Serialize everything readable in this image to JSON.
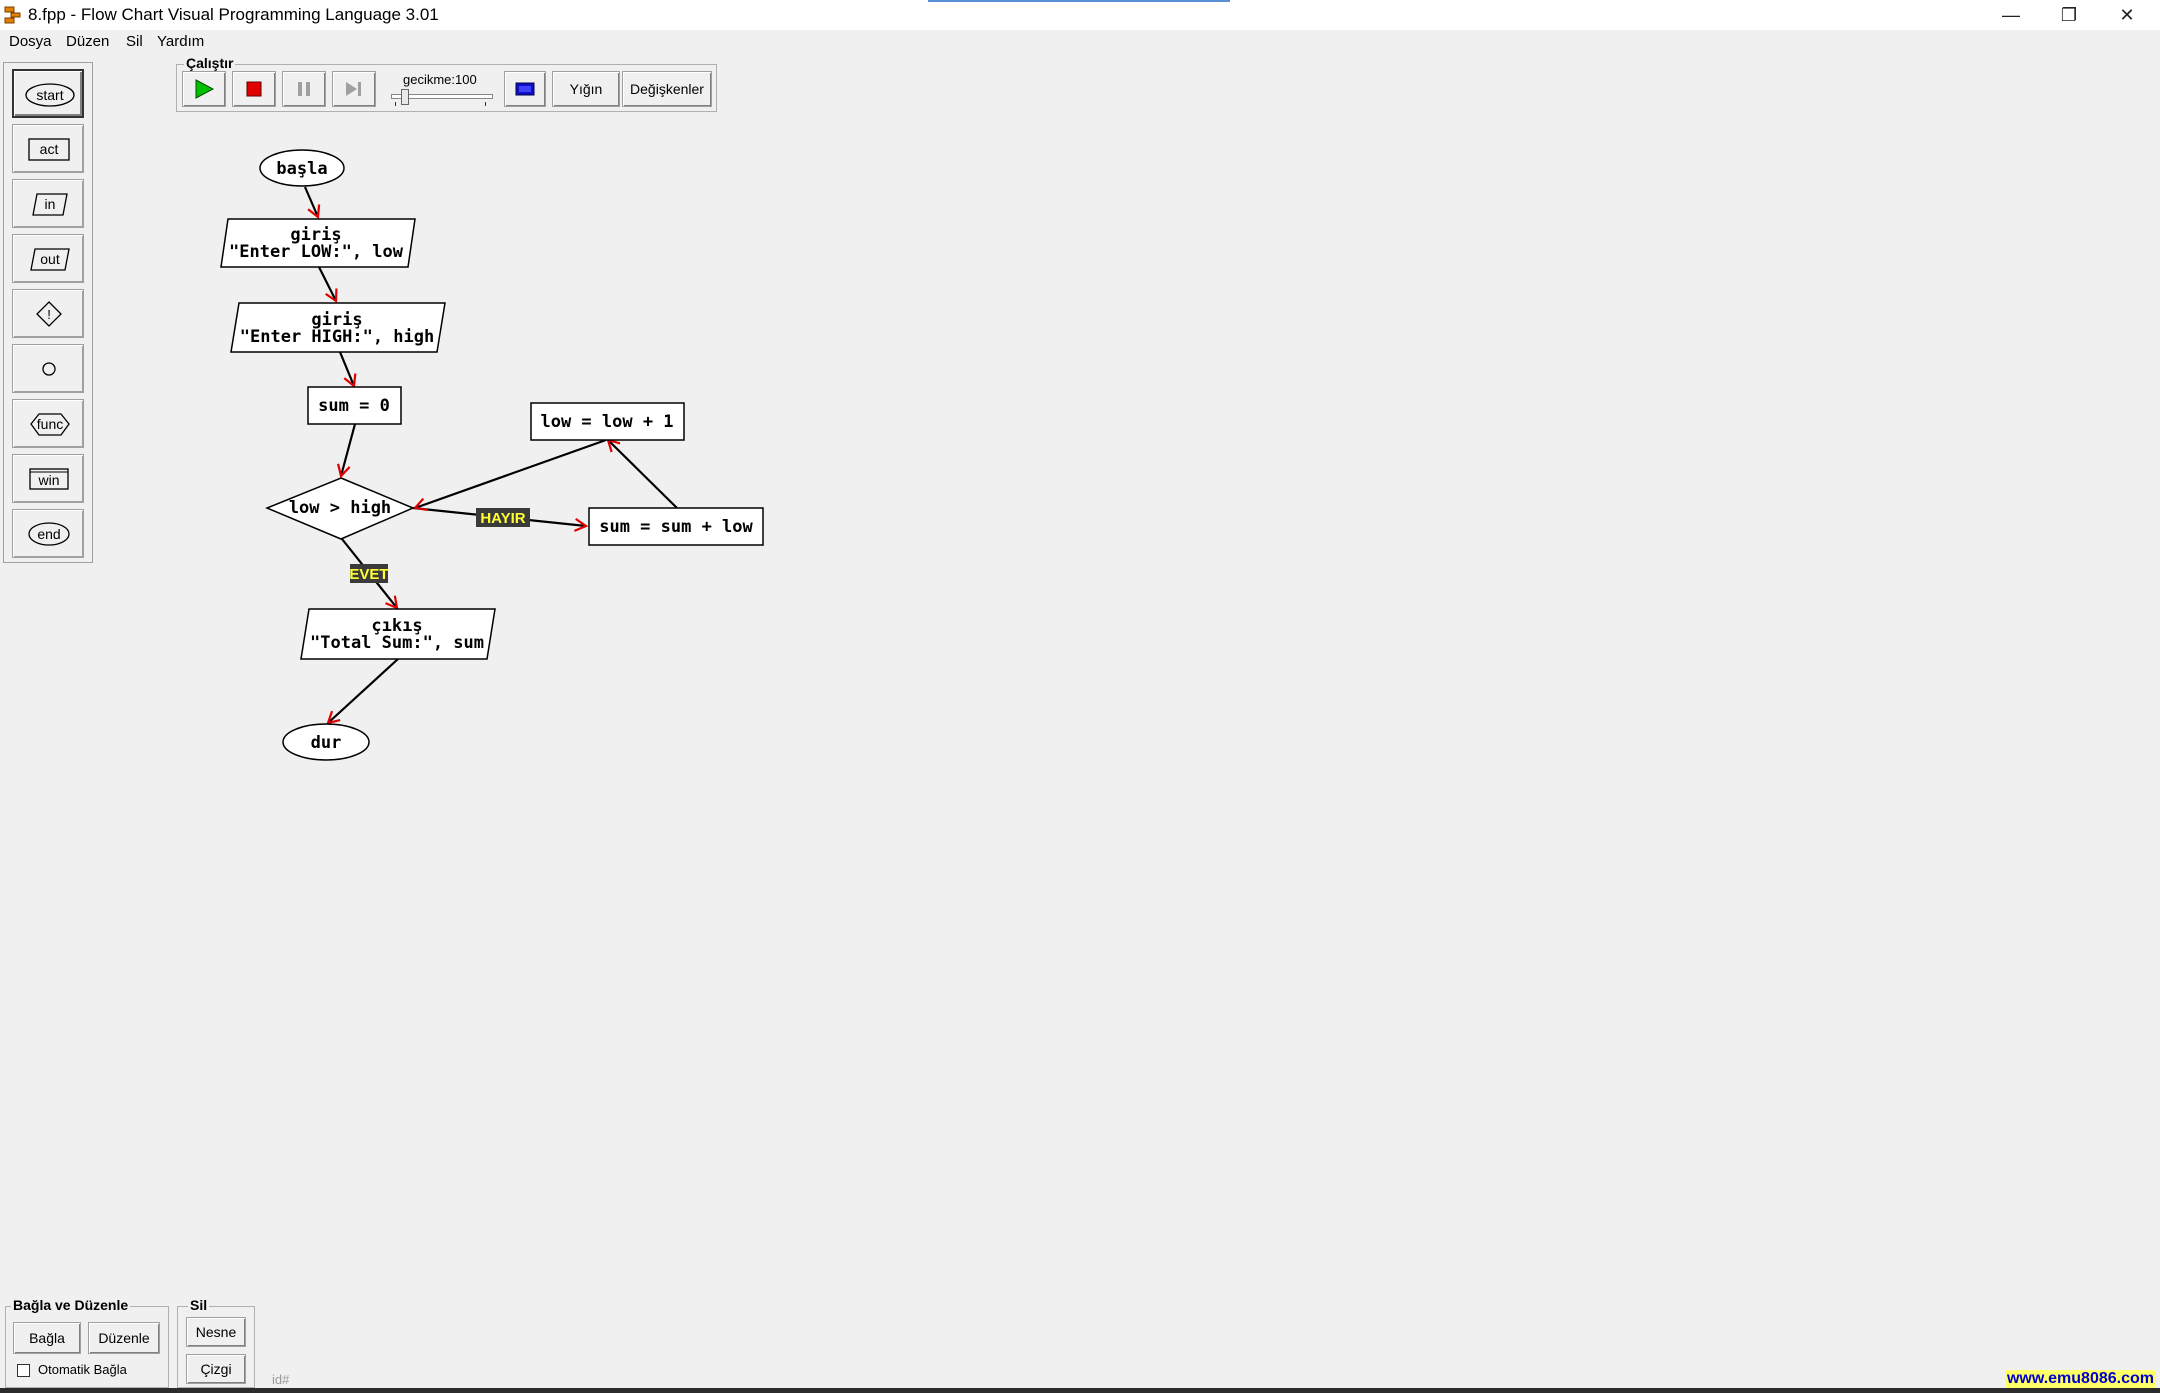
{
  "window": {
    "title": "8.fpp - Flow Chart Visual Programming Language 3.01",
    "controls": [
      "—",
      "❐",
      "✕"
    ]
  },
  "menu": [
    "Dosya",
    "Düzen",
    "Sil",
    "Yardım"
  ],
  "palette": {
    "items": [
      "start",
      "act",
      "in",
      "out",
      "",
      "",
      "func",
      "win",
      "end"
    ],
    "selected": "start"
  },
  "run_group": {
    "label": "Çalıştır",
    "delay_label": "gecikme:100",
    "delay_value": 100,
    "stack_label": "Yığın",
    "variables_label": "Değişkenler"
  },
  "flowchart": {
    "start": "başla",
    "input1": [
      "giriş",
      "\"Enter LOW:\", low"
    ],
    "input2": [
      "giriş",
      "\"Enter HIGH:\", high"
    ],
    "init": "sum = 0",
    "condition": "low > high",
    "increment": "low = low + 1",
    "accumulate": "sum = sum + low",
    "no_label": "HAYIR",
    "yes_label": "EVET",
    "output": [
      "çıkış",
      "\"Total Sum:\", sum"
    ],
    "end": "dur"
  },
  "bottom": {
    "connect_group_label": "Bağla ve Düzenle",
    "connect_label": "Bağla",
    "edit_label": "Düzenle",
    "auto_connect_label": "Otomatik Bağla",
    "auto_connect_checked": false,
    "delete_group_label": "Sil",
    "object_label": "Nesne",
    "line_label": "Çizgi",
    "id_mark": "id#"
  },
  "footer_link": "www.emu8086.com",
  "colors": {
    "arrow": "#e00000",
    "tag_bg": "#3a3a3a",
    "tag_fg": "#ffff33",
    "play": "#00c000",
    "stop": "#e00000"
  }
}
